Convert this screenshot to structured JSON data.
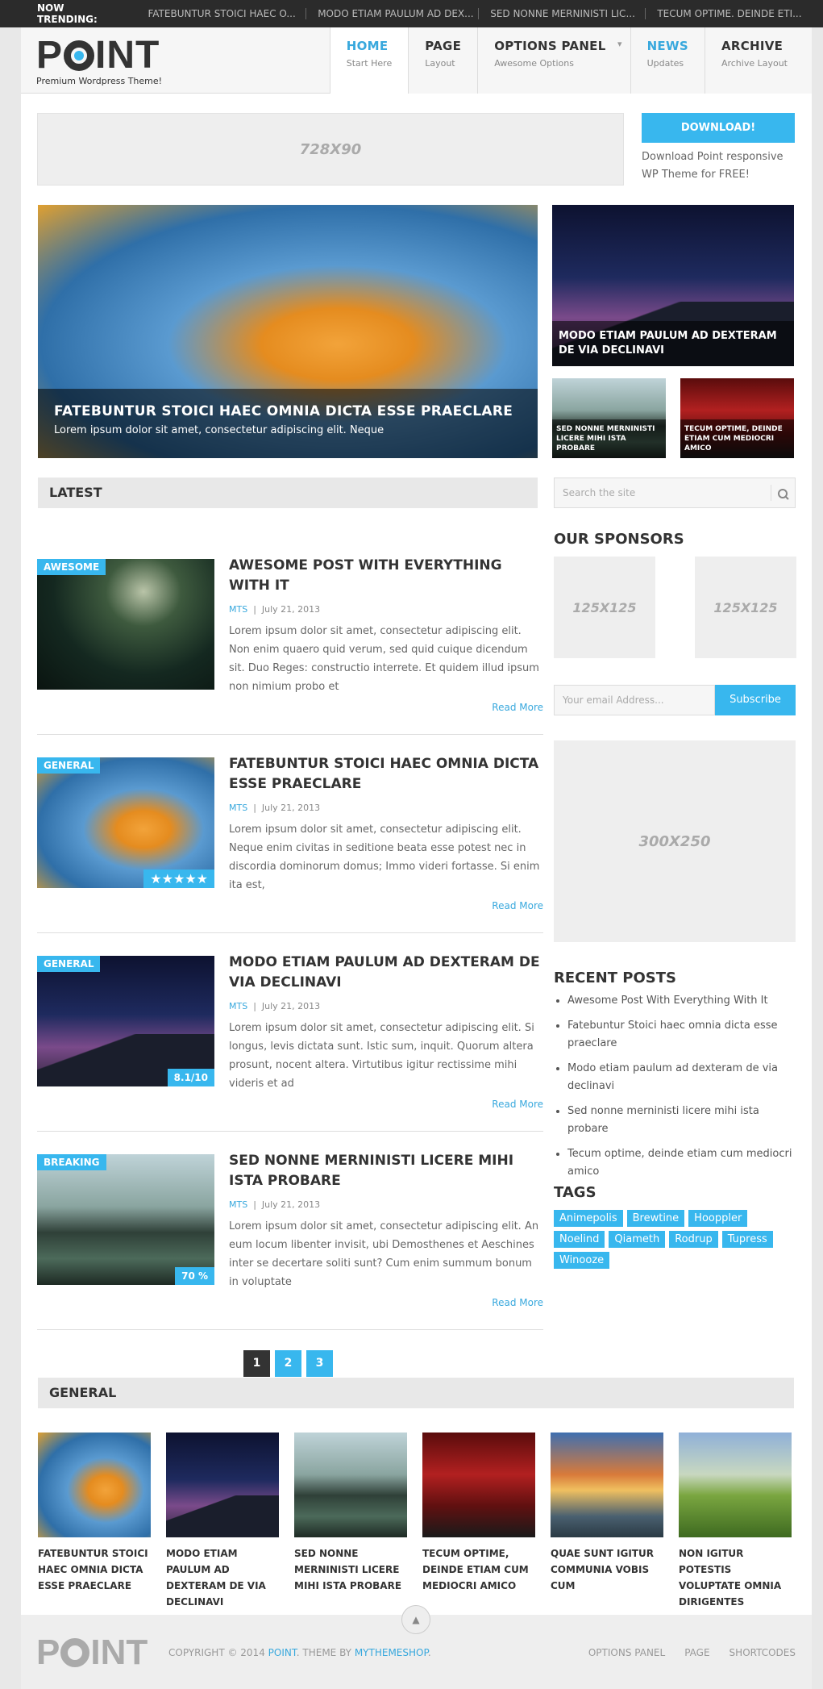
{
  "trending": {
    "label": "NOW TRENDING:",
    "items": [
      "FATEBUNTUR STOICI HAEC O...",
      "MODO ETIAM PAULUM AD DEX...",
      "SED NONNE MERNINISTI LIC...",
      "TECUM OPTIME. DEINDE ETI..."
    ]
  },
  "logo": {
    "p": "P",
    "int": "INT",
    "tagline": "Premium Wordpress Theme!"
  },
  "nav": [
    {
      "title": "HOME",
      "sub": "Start Here"
    },
    {
      "title": "PAGE",
      "sub": "Layout"
    },
    {
      "title": "OPTIONS PANEL",
      "sub": "Awesome Options",
      "arrow": "▾"
    },
    {
      "title": "NEWS",
      "sub": "Updates"
    },
    {
      "title": "ARCHIVE",
      "sub": "Archive Layout"
    }
  ],
  "ad_top": "728X90",
  "download": {
    "button": "DOWNLOAD!",
    "text": "Download Point responsive WP Theme for FREE!"
  },
  "slider": {
    "main": {
      "title": "FATEBUNTUR STOICI HAEC OMNIA DICTA ESSE PRAECLARE",
      "sub": "Lorem ipsum dolor sit amet, consectetur adipiscing elit. Neque"
    },
    "right_top": "MODO ETIAM PAULUM AD DEXTERAM DE VIA DECLINAVI",
    "small_1": "SED NONNE MERNINISTI LICERE MIHI ISTA PROBARE",
    "small_2": "TECUM OPTIME, DEINDE ETIAM CUM MEDIOCRI AMICO"
  },
  "latest_heading": "LATEST",
  "posts": [
    {
      "badge": "AWESOME",
      "score": "",
      "title": "AWESOME POST WITH EVERYTHING WITH IT",
      "author": "MTS",
      "date": "July 21, 2013",
      "excerpt": "Lorem ipsum dolor sit amet, consectetur adipiscing elit. Non enim quaero quid verum, sed quid cuique dicendum sit. Duo Reges: constructio interrete. Et quidem illud ipsum non nimium probo et",
      "read": "Read More"
    },
    {
      "badge": "GENERAL",
      "score": "★★★★★",
      "title": "FATEBUNTUR STOICI HAEC OMNIA DICTA ESSE PRAECLARE",
      "author": "MTS",
      "date": "July 21, 2013",
      "excerpt": "Lorem ipsum dolor sit amet, consectetur adipiscing elit. Neque enim civitas in seditione beata esse potest nec in discordia dominorum domus; Immo videri fortasse. Si enim ita est,",
      "read": "Read More"
    },
    {
      "badge": "GENERAL",
      "score": "8.1/10",
      "title": "MODO ETIAM PAULUM AD DEXTERAM DE VIA DECLINAVI",
      "author": "MTS",
      "date": "July 21, 2013",
      "excerpt": "Lorem ipsum dolor sit amet, consectetur adipiscing elit. Si longus, levis dictata sunt. Istic sum, inquit. Quorum altera prosunt, nocent altera. Virtutibus igitur rectissime mihi videris et ad",
      "read": "Read More"
    },
    {
      "badge": "BREAKING",
      "score": "70 %",
      "title": "SED NONNE MERNINISTI LICERE MIHI ISTA PROBARE",
      "author": "MTS",
      "date": "July 21, 2013",
      "excerpt": "Lorem ipsum dolor sit amet, consectetur adipiscing elit. An eum locum libenter invisit, ubi Demosthenes et Aeschines inter se decertare soliti sunt? Cum enim summum bonum in voluptate",
      "read": "Read More"
    }
  ],
  "pager": [
    "1",
    "2",
    "3"
  ],
  "sidebar": {
    "search_placeholder": "Search the site",
    "sponsors_title": "OUR SPONSORS",
    "ad125": "125X125",
    "email_placeholder": "Your email Address...",
    "subscribe": "Subscribe",
    "ad300": "300X250",
    "recent_title": "RECENT POSTS",
    "recent": [
      "Awesome Post With Everything With It",
      "Fatebuntur Stoici haec omnia dicta esse praeclare",
      "Modo etiam paulum ad dexteram de via declinavi",
      "Sed nonne merninisti licere mihi ista probare",
      "Tecum optime, deinde etiam cum mediocri amico"
    ],
    "tags_title": "TAGS",
    "tags": [
      "Animepolis",
      "Brewtine",
      "Hooppler",
      "Noelind",
      "Qiameth",
      "Rodrup",
      "Tupress",
      "Winooze"
    ]
  },
  "general_heading": "GENERAL",
  "general": [
    "FATEBUNTUR STOICI HAEC OMNIA DICTA ESSE PRAECLARE",
    "MODO ETIAM PAULUM AD DEXTERAM DE VIA DECLINAVI",
    "SED NONNE MERNINISTI LICERE MIHI ISTA PROBARE",
    "TECUM OPTIME, DEINDE ETIAM CUM MEDIOCRI AMICO",
    "QUAE SUNT IGITUR COMMUNIA VOBIS CUM",
    "NON IGITUR POTESTIS VOLUPTATE OMNIA DIRIGENTES"
  ],
  "footer": {
    "copy_pre": "COPYRIGHT © 2014",
    "copy_site": "POINT",
    "copy_mid": ". THEME BY",
    "copy_by": "MYTHEMESHOP",
    "links": [
      "OPTIONS PANEL",
      "PAGE",
      "SHORTCODES"
    ]
  }
}
